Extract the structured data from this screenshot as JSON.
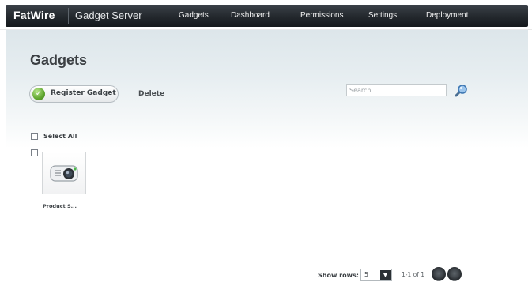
{
  "header": {
    "brand": "FatWire",
    "product": "Gadget Server",
    "nav": [
      "Gadgets",
      "Dashboard",
      "Permissions",
      "Settings",
      "Deployment"
    ]
  },
  "main": {
    "title": "Gadgets",
    "register_label": "Register Gadget",
    "register_icon": "check-icon",
    "delete_label": "Delete",
    "search_placeholder": "Search",
    "search_icon": "magnifier-icon",
    "select_all_label": "Select All",
    "gadgets": [
      {
        "name": "Product S...",
        "icon": "projector-icon"
      }
    ]
  },
  "pagination": {
    "show_rows_label": "Show rows:",
    "rows_value": "5",
    "page_info": "1-1 of 1"
  },
  "colors": {
    "nav_bg": "#23282d",
    "accent_green": "#5fa52e",
    "content_bg": "#e7eef1"
  }
}
